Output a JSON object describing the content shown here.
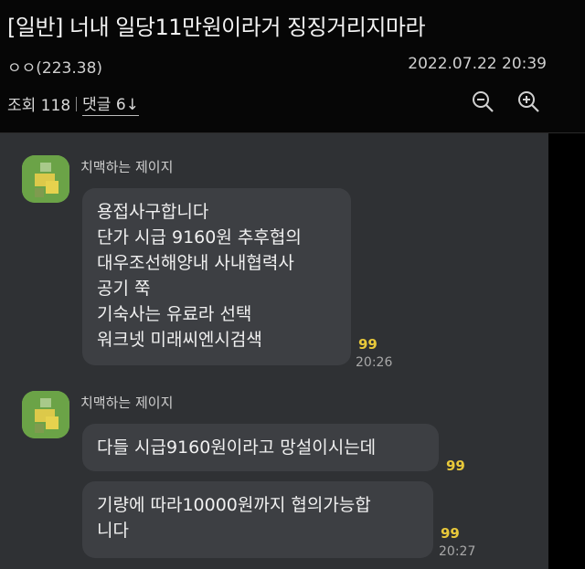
{
  "post": {
    "title": "[일반] 너내 일당11만원이라거 징징거리지마라",
    "author": "ㅇㅇ(223.38)",
    "date": "2022.07.22 20:39",
    "views": "조회 118",
    "comments": "댓글 6↓",
    "zoom_out_icon": "zoom-out-icon",
    "zoom_in_icon": "zoom-in-icon"
  },
  "chat": {
    "messages": [
      {
        "sender": "치맥하는 제이지",
        "lines": [
          "용접사구합니다",
          "단가 시급 9160원 추후협의",
          "대우조선해양내 사내협력사",
          "공기 쭉",
          "기숙사는 유료라 선택",
          "워크넷 미래씨엔시검색"
        ],
        "unread": "99",
        "time": "20:26"
      },
      {
        "sender": "치맥하는 제이지",
        "bubbles": [
          {
            "lines": [
              "다들 시급9160원이라고 망설이시는데"
            ],
            "unread": "99",
            "time": ""
          },
          {
            "lines": [
              "기량에 따라10000원까지 협의가능합",
              "니다"
            ],
            "unread": "99",
            "time": "20:27"
          }
        ]
      }
    ]
  },
  "colors": {
    "background": "#000000",
    "chat_background": "#2f3134",
    "bubble": "#3d3f43",
    "unread": "#e9c93a"
  }
}
